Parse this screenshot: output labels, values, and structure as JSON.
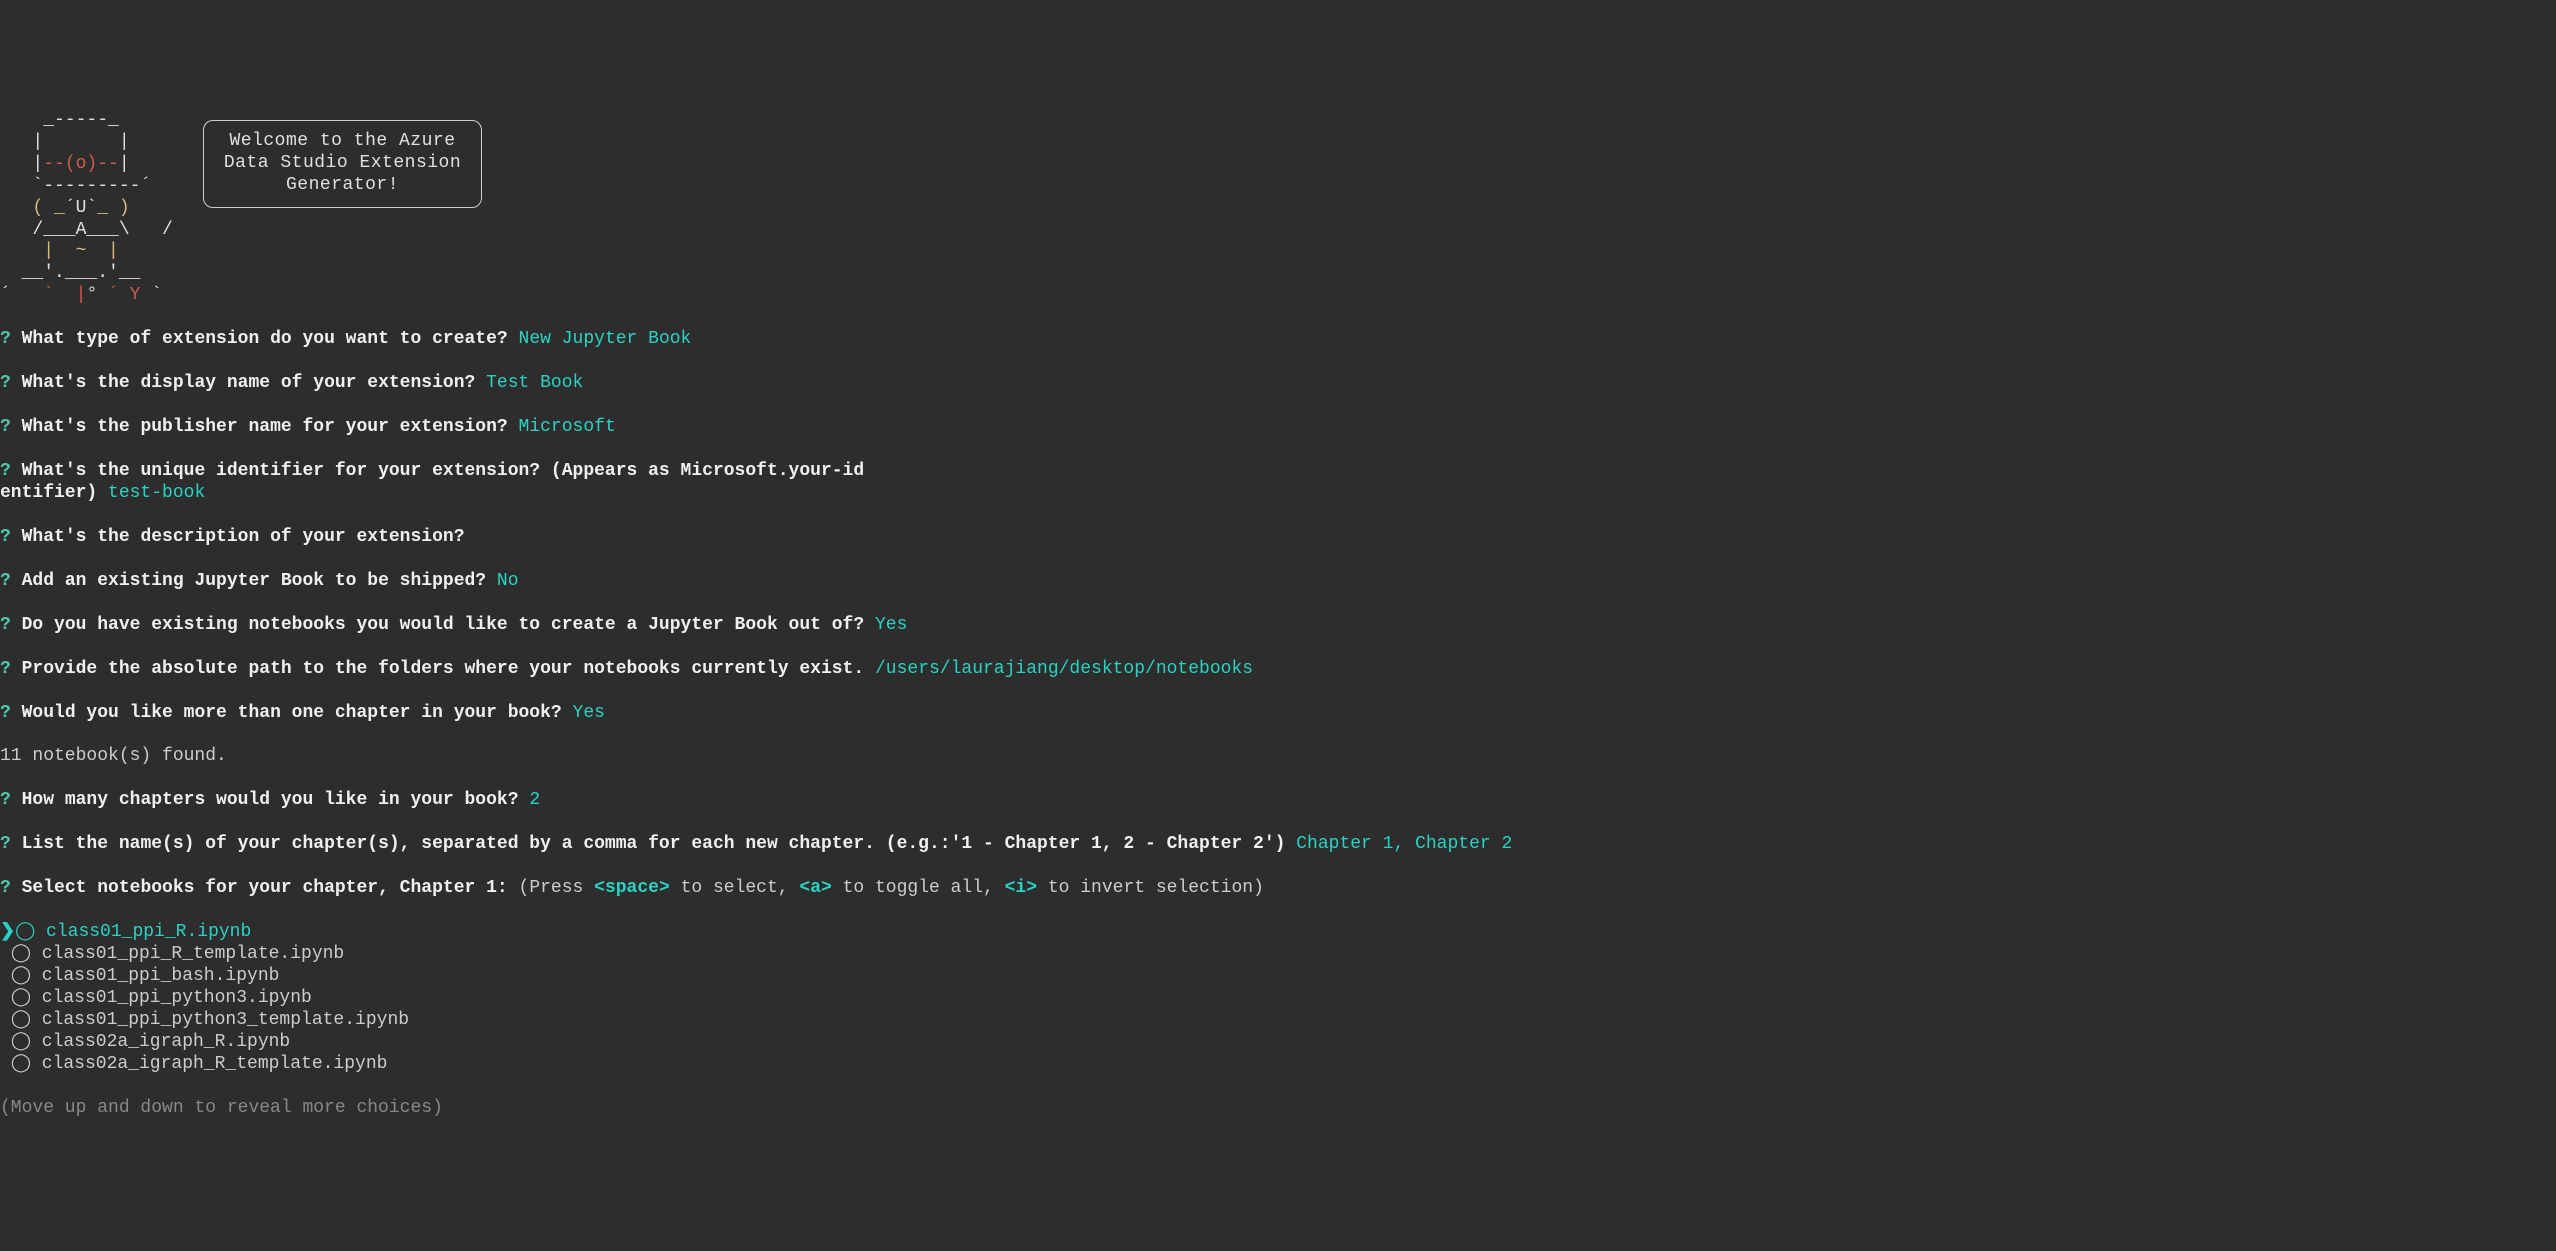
{
  "ascii": {
    "l1": "    _-----_",
    "l2_a": "   |       |",
    "l3_a": "   |",
    "l3_b": "--(o)--",
    "l3_c": "|",
    "l4": "   `---------´",
    "l5_a": "   ",
    "l5_b": "( ",
    "l5_c": "_",
    "l5_d": "´U`",
    "l5_e": "_",
    "l5_f": " )",
    "l6": "   /___A___\\   /",
    "l7_a": "    ",
    "l7_b": "|  ~  |",
    "l8": "  __'.___.'__",
    "l9_a": "´   ",
    "l9_b": "`  |",
    "l9_c": "° ",
    "l9_d": "´ Y",
    "l9_e": " `"
  },
  "welcome": "Welcome to the Azure\nData Studio Extension\nGenerator!",
  "prompts": [
    {
      "q": "What type of extension do you want to create?",
      "a": "New Jupyter Book"
    },
    {
      "q": "What's the display name of your extension?",
      "a": "Test Book"
    },
    {
      "q": "What's the publisher name for your extension?",
      "a": "Microsoft"
    },
    {
      "q": "What's the unique identifier for your extension? (Appears as Microsoft.your-id",
      "cont": "entifier)",
      "a": "test-book"
    },
    {
      "q": "What's the description of your extension?",
      "a": ""
    },
    {
      "q": "Add an existing Jupyter Book to be shipped?",
      "a": "No"
    },
    {
      "q": "Do you have existing notebooks you would like to create a Jupyter Book out of?",
      "a": "Yes"
    },
    {
      "q": "Provide the absolute path to the folders where your notebooks currently exist.",
      "a": "/users/laurajiang/desktop/notebooks"
    },
    {
      "q": "Would you like more than one chapter in your book?",
      "a": "Yes"
    }
  ],
  "found_text": "11 notebook(s) found.",
  "chapters_q": "How many chapters would you like in your book?",
  "chapters_a": "2",
  "list_q": "List the name(s) of your chapter(s), separated by a comma for each new chapter. (e.g.:'1 - Chapter 1, 2 - Chapter 2')",
  "list_a": "Chapter 1, Chapter 2",
  "select_q": "Select notebooks for your chapter, Chapter 1:",
  "select_hint_pre": " (Press ",
  "select_hint_space": "<space>",
  "select_hint_mid1": " to select, ",
  "select_hint_a": "<a>",
  "select_hint_mid2": " to toggle all, ",
  "select_hint_i": "<i>",
  "select_hint_end": " to invert selection)",
  "items": [
    {
      "name": "class01_ppi_R.ipynb",
      "current": true
    },
    {
      "name": "class01_ppi_R_template.ipynb",
      "current": false
    },
    {
      "name": "class01_ppi_bash.ipynb",
      "current": false
    },
    {
      "name": "class01_ppi_python3.ipynb",
      "current": false
    },
    {
      "name": "class01_ppi_python3_template.ipynb",
      "current": false
    },
    {
      "name": "class02a_igraph_R.ipynb",
      "current": false
    },
    {
      "name": "class02a_igraph_R_template.ipynb",
      "current": false
    }
  ],
  "more_hint": "(Move up and down to reveal more choices)"
}
